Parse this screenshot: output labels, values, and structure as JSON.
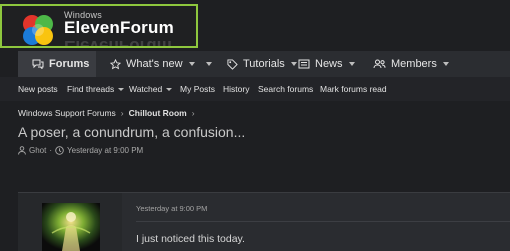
{
  "logo": {
    "prefix": "Windows",
    "title": "ElevenForum"
  },
  "nav": {
    "items": [
      {
        "label": "Forums",
        "icon": "chat-bubbles-icon"
      },
      {
        "label": "What's new",
        "icon": "star-icon"
      },
      {
        "label": "Find threads",
        "icon": "none"
      },
      {
        "label": "Tutorials",
        "icon": "tag-icon"
      },
      {
        "label": "News",
        "icon": "newspaper-icon"
      },
      {
        "label": "Members",
        "icon": "users-icon"
      }
    ]
  },
  "subnav": {
    "items": [
      {
        "label": "New posts"
      },
      {
        "label": "Find threads"
      },
      {
        "label": "Watched"
      },
      {
        "label": "My Posts"
      },
      {
        "label": "History"
      },
      {
        "label": "Search forums"
      },
      {
        "label": "Mark forums read"
      }
    ]
  },
  "breadcrumb": {
    "items": [
      "Windows Support Forums",
      "Chillout Room"
    ]
  },
  "thread": {
    "title": "A poser, a conundrum, a confusion...",
    "author": "Ghot",
    "date": "Yesterday at 9:00 PM"
  },
  "post": {
    "date": "Yesterday at 9:00 PM",
    "text": "I just noticed this today."
  },
  "colors": {
    "accent": "#8ec73e",
    "background": "#1e1f22",
    "nav": "#2b2d31"
  }
}
